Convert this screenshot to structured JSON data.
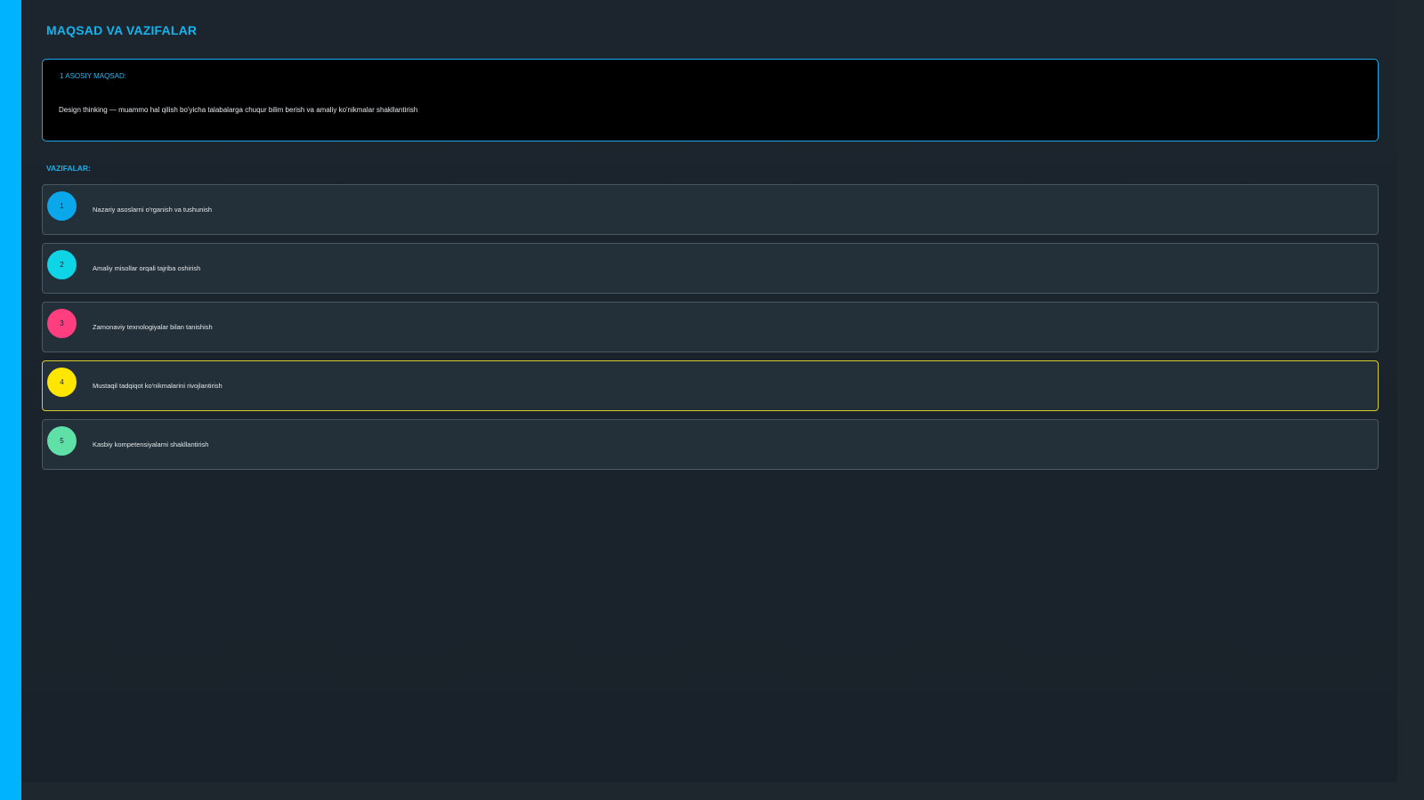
{
  "page": {
    "title": "MAQSAD VA VAZIFALAR"
  },
  "goal": {
    "label": "1 ASOSIY MAQSAD:",
    "text": "Design thinking — muammo hal qilish bo'yicha talabalarga chuqur bilim berish va amaliy ko'nikmalar shakllantirish"
  },
  "tasks": {
    "heading": "VAZIFALAR:",
    "items": [
      {
        "number": "1",
        "text": "Nazariy asoslarni o'rganish va tushunish",
        "color": "#0aa7ea"
      },
      {
        "number": "2",
        "text": "Amaliy misollar orqali tajriba oshirish",
        "color": "#0fd4e6"
      },
      {
        "number": "3",
        "text": "Zamonaviy texnologiyalar bilan tanishish",
        "color": "#ff3d7f"
      },
      {
        "number": "4",
        "text": "Mustaqil tadqiqot ko'nikmalarini rivojlantirish",
        "color": "#ffe600"
      },
      {
        "number": "5",
        "text": "Kasbiy kompetensiyalarni shakllantirish",
        "color": "#5ee0a6"
      }
    ]
  },
  "colors": {
    "accent": "#00b3ff",
    "background": "#1b232b",
    "highlight_border": "#d6cf2a"
  }
}
